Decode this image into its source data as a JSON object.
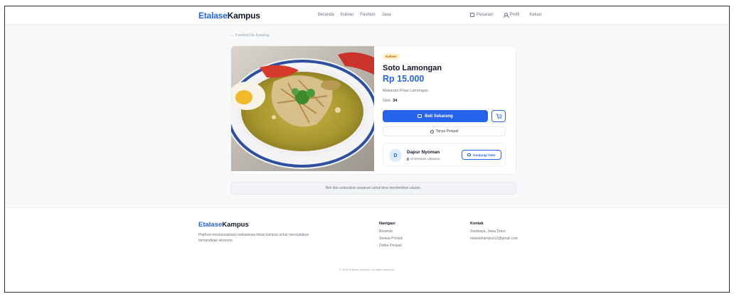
{
  "nav": {
    "brand_part1": "Etalase",
    "brand_part2": "Kampus",
    "links": [
      "Beranda",
      "Kuliner",
      "Fashion",
      "Jasa"
    ],
    "orders": "Pesanan",
    "profile": "Profil",
    "logout": "Keluar"
  },
  "back_link": "← Kembali ke Katalog",
  "product": {
    "category": "Kuliner",
    "name": "Soto Lamongan",
    "price": "Rp 15.000",
    "description": "Makanan Khas Lamongan",
    "stock_label": "Stok:",
    "stock_value": "34",
    "buy_label": "Beli Sekarang",
    "ask_label": "Tanya Penjual"
  },
  "seller": {
    "initial": "D",
    "name": "Dapur Nyoman",
    "campus": "Universitas Udayana",
    "visit_label": "Kunjungi Toko"
  },
  "review_notice": "Beli dan selesaikan pesanan untuk bisa memberikan ulasan.",
  "footer": {
    "brand_part1": "Etalase",
    "brand_part2": "Kampus",
    "description": "Platform kewirausahaan mahasiswa lintas kampus untuk menciptakan kemandirian ekonomi.",
    "nav_title": "Navigasi",
    "nav_items": [
      "Beranda",
      "Semua Produk",
      "Daftar Penjual"
    ],
    "contact_title": "Kontak",
    "contact_items": [
      "Surabaya, Jawa Timur",
      "etalasekampus12@gmail.com"
    ],
    "copyright": "© 2026 Etalase Kampus. All rights reserved."
  },
  "colors": {
    "accent": "#2563eb",
    "badge_bg": "#fef3c7",
    "badge_text": "#b45309"
  }
}
